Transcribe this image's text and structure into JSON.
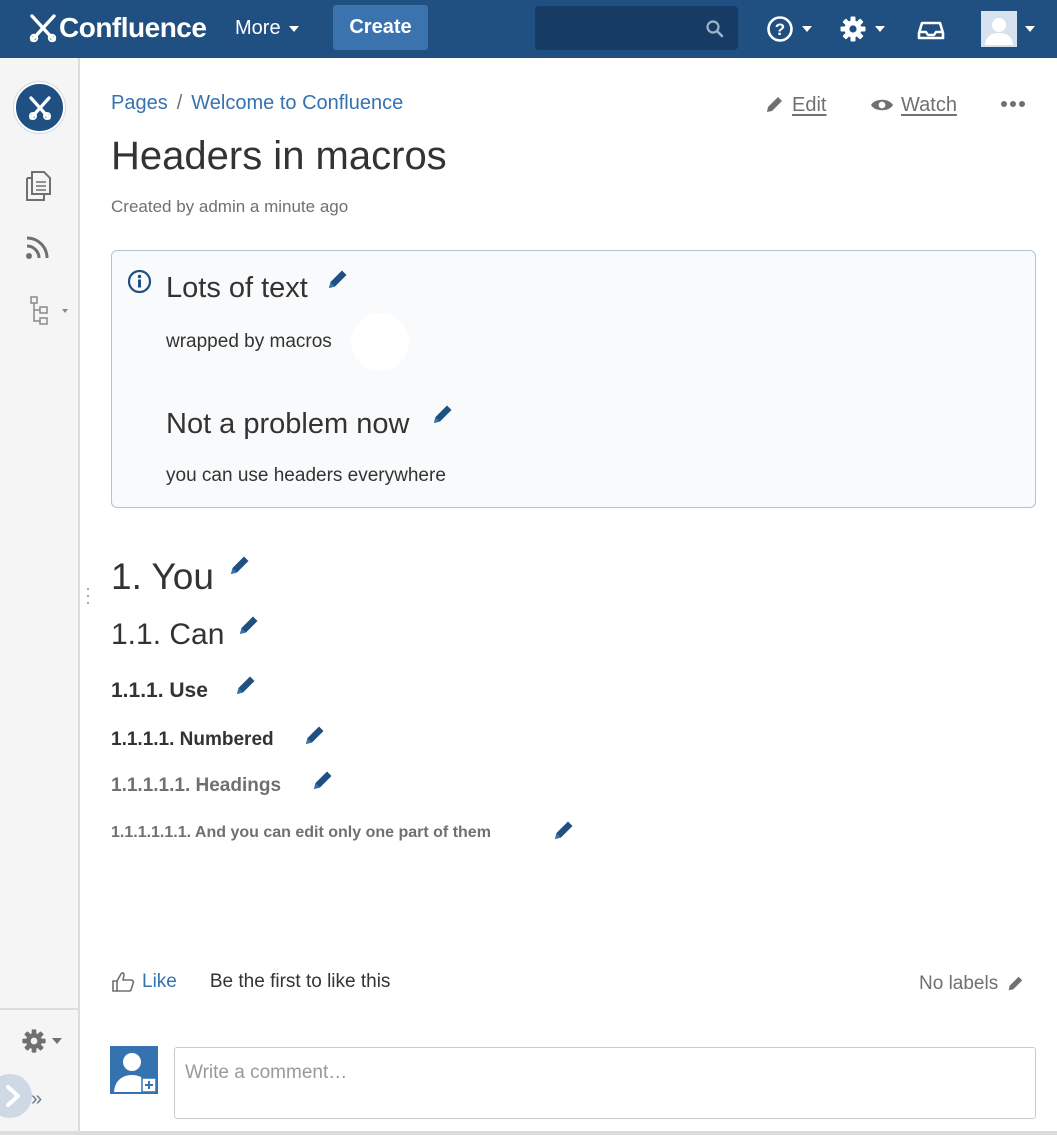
{
  "colors": {
    "nav_bg": "#205081",
    "create_bg": "#3b73af",
    "link": "#3572b0",
    "muted": "#707070",
    "pencil": "#205081"
  },
  "topnav": {
    "logo_text": "Confluence",
    "more_label": "More",
    "create_label": "Create",
    "search_placeholder": "",
    "icons": [
      "help-icon",
      "gear-icon",
      "notifications-inbox-icon",
      "user-avatar-icon"
    ]
  },
  "sidebar": {
    "icons": [
      "space-logo-icon",
      "pages-icon",
      "blog-feed-icon",
      "page-tree-icon",
      "space-settings-icon",
      "collapse-sidebar-icon"
    ]
  },
  "breadcrumb": {
    "items": [
      "Pages",
      "Welcome to Confluence"
    ],
    "separator": "/"
  },
  "page_actions": {
    "edit_label": "Edit",
    "watch_label": "Watch"
  },
  "page": {
    "title": "Headers in macros",
    "meta": "Created by admin a minute ago"
  },
  "info_panel": {
    "heading1": "Lots of text",
    "text1": "wrapped by macros",
    "heading2": "Not a problem now",
    "text2": "you can use headers everywhere"
  },
  "headings": {
    "h1": "1. You",
    "h2": "1.1. Can",
    "h3": "1.1.1. Use",
    "h4": "1.1.1.1. Numbered",
    "h5": "1.1.1.1.1. Headings",
    "h6": "1.1.1.1.1.1. And you can edit only one part of them"
  },
  "footer": {
    "like_label": "Like",
    "like_status": "Be the first to like this",
    "labels_text": "No labels",
    "comment_placeholder": "Write a comment…"
  }
}
